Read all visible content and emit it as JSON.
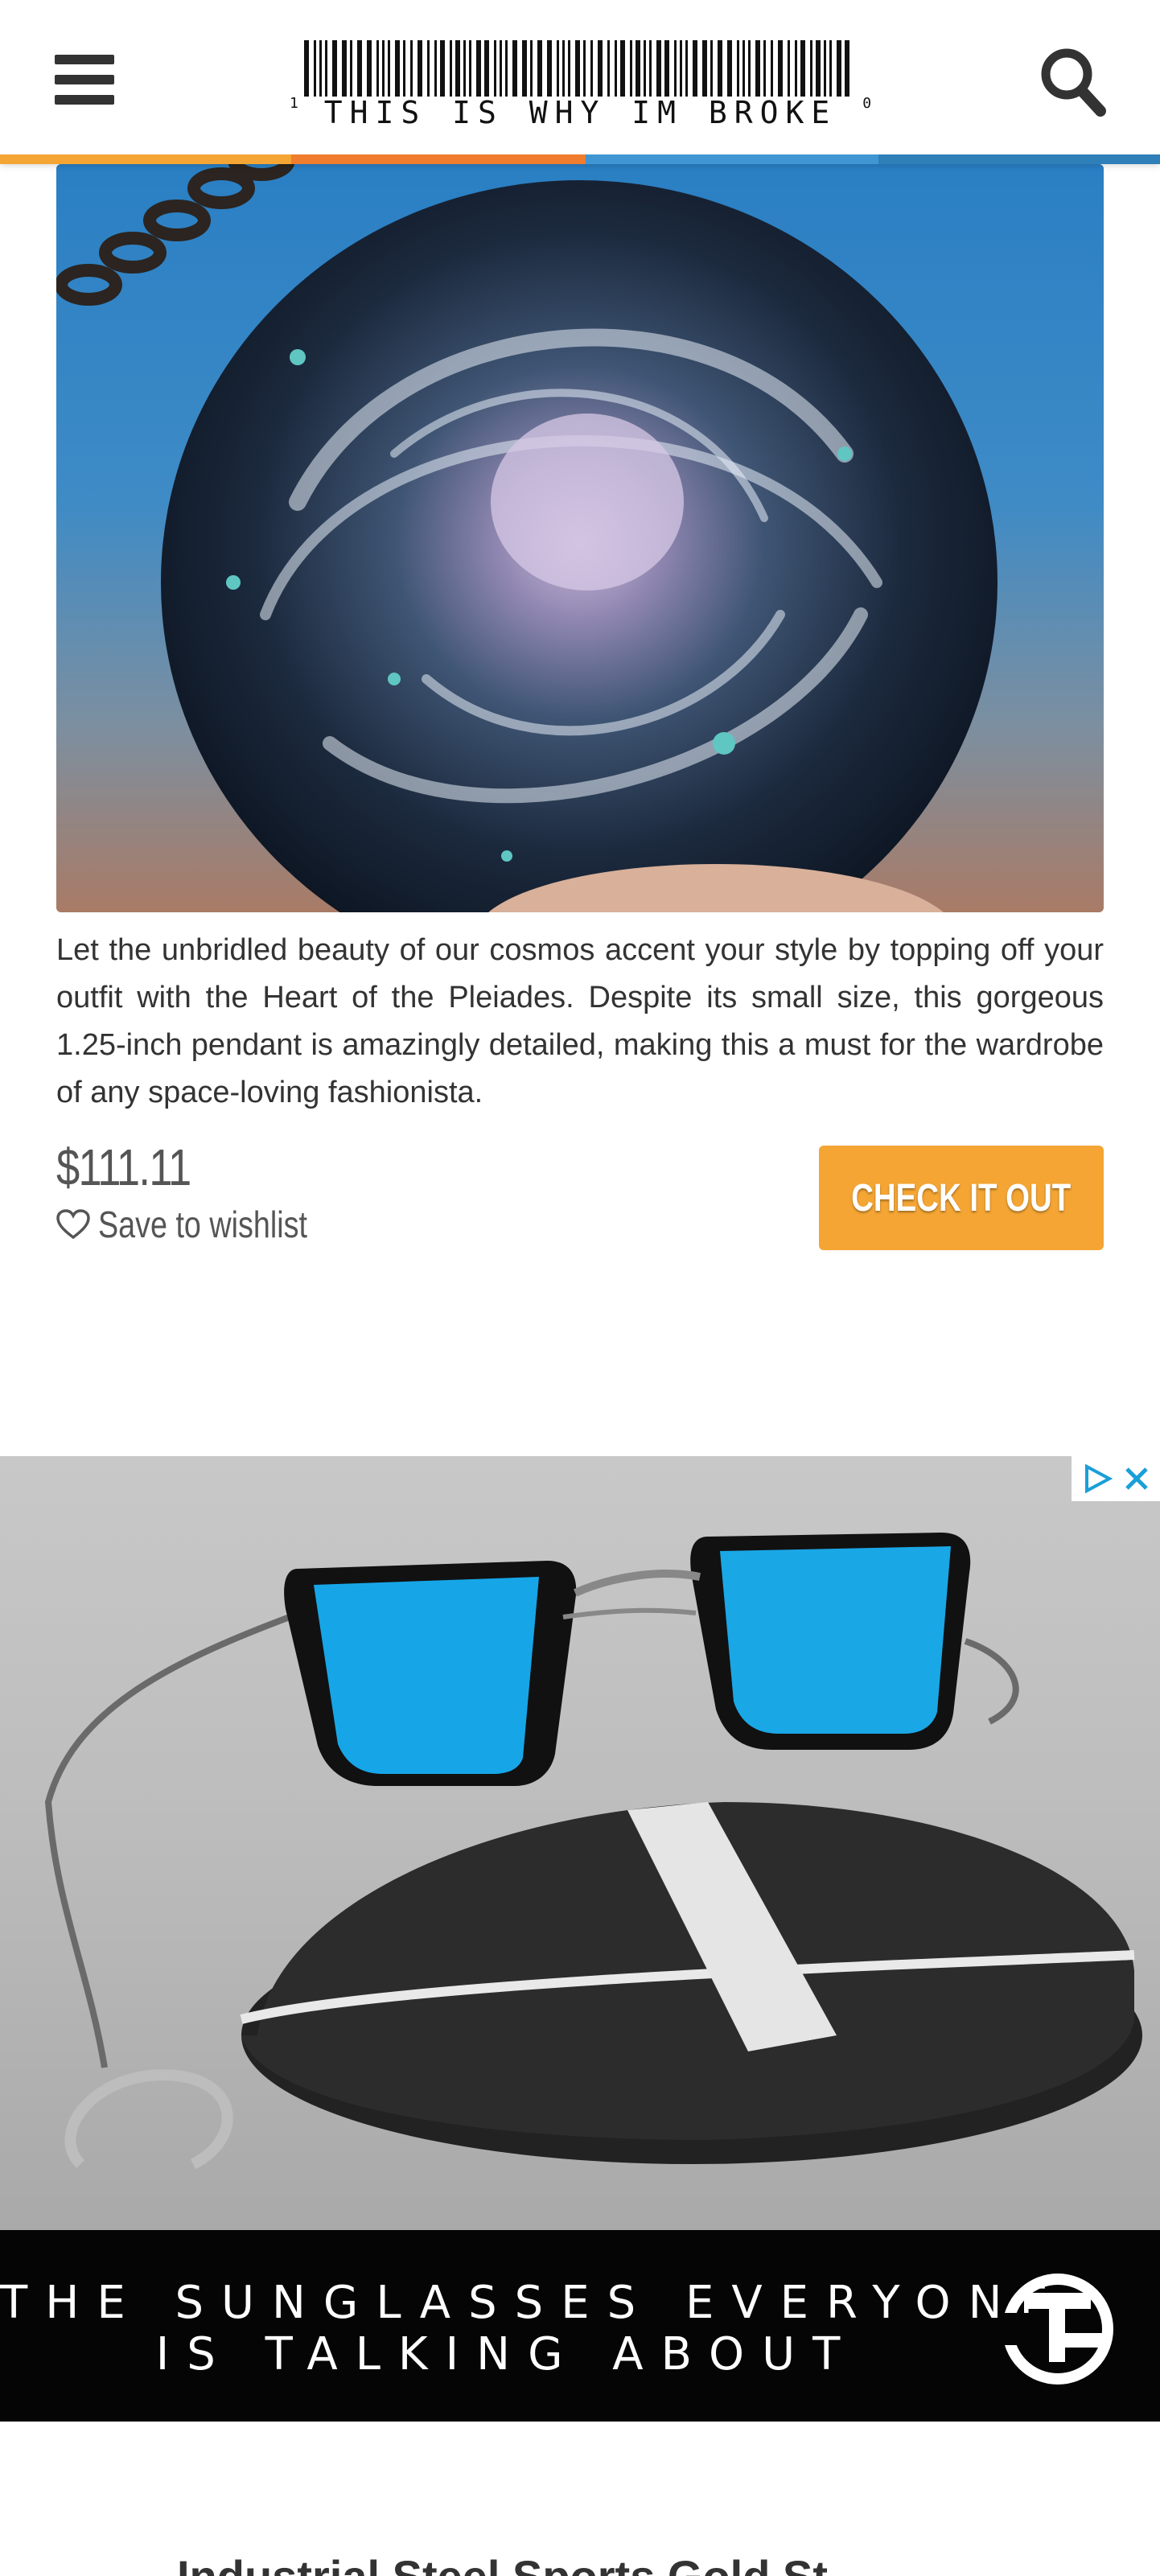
{
  "header": {
    "logo_text": "THIS IS WHY IM BROKE",
    "logo_left_digit": "1",
    "logo_right_digit": "0",
    "stripe_colors": [
      "#f4a533",
      "#ef7d2d",
      "#3f96d3",
      "#2f7fb8"
    ]
  },
  "product": {
    "description": "Let the unbridled beauty of our cosmos accent your style by topping off your outfit with the Heart of the Pleiades. Despite its small size, this gorgeous 1.25-inch pendant is amazingly detailed, making this a must for the wardrobe of any space-loving fashionista.",
    "price": "$111.11",
    "wishlist_label": "Save to wishlist",
    "cta_label": "CHECK IT OUT",
    "accent_color": "#f4a533"
  },
  "ad": {
    "headline_line1": "THE SUNGLASSES EVERYONE",
    "headline_line2": "IS TALKING ABOUT",
    "logo_letters": "TG"
  },
  "next_product": {
    "title_partial": "Industrial Steel Sports Gold St..."
  },
  "icons": {
    "menu": "hamburger-icon",
    "search": "search-icon",
    "wishlist": "heart-outline-icon",
    "ad_choices": "ad-choices-icon",
    "ad_close": "close-icon"
  }
}
